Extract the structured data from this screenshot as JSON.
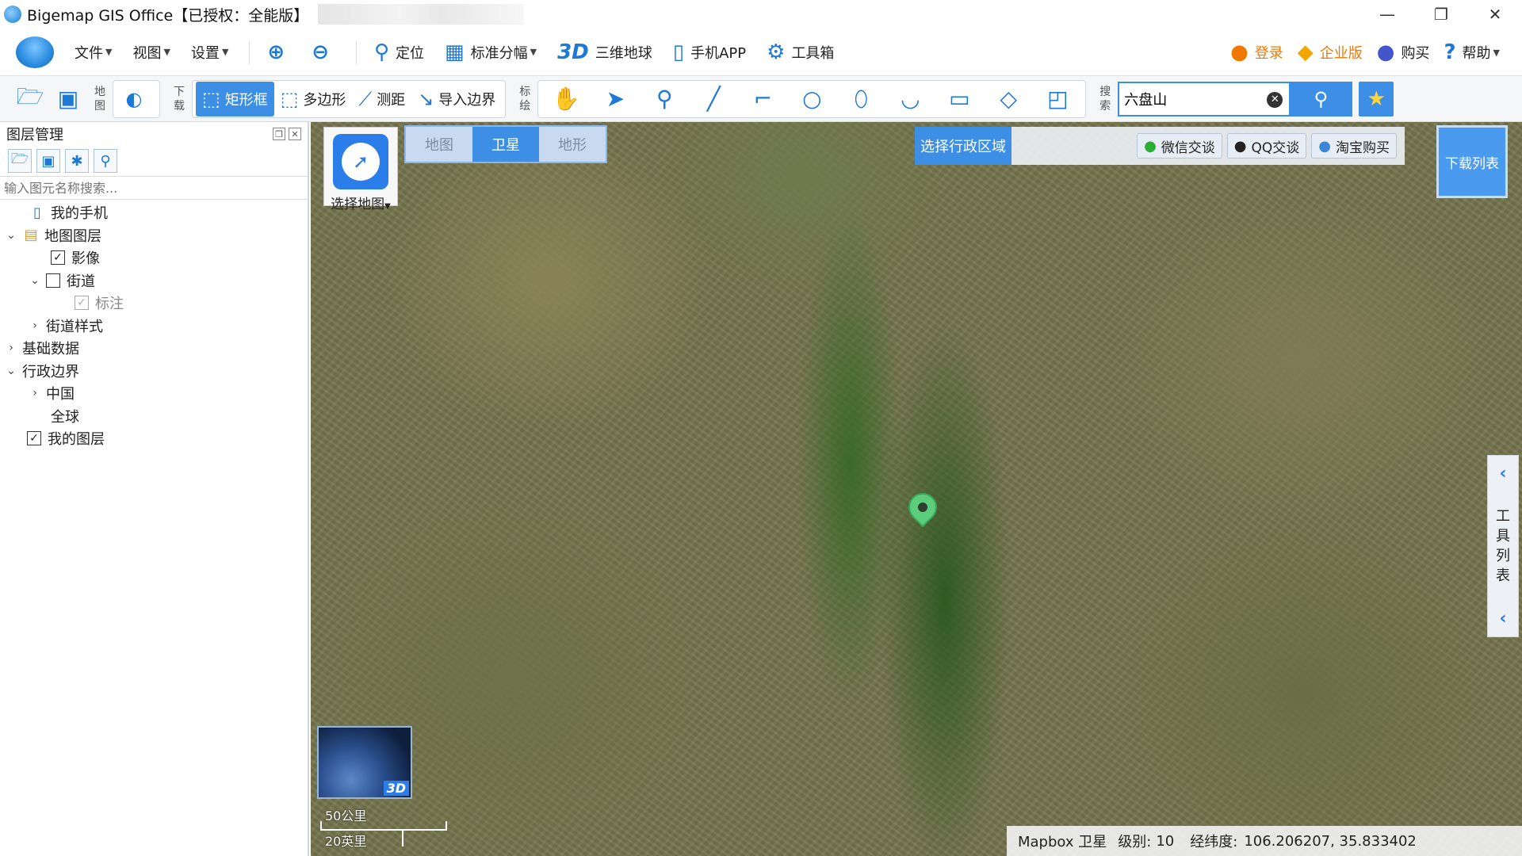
{
  "window": {
    "title": "Bigemap GIS Office【已授权：全能版】",
    "controls": {
      "minimize": "—",
      "restore": "❐",
      "close": "✕"
    }
  },
  "menubar": {
    "file": "文件",
    "view": "视图",
    "settings": "设置",
    "locate": "定位",
    "grid": "标准分幅",
    "globe_3d_prefix": "3D",
    "globe_3d": "三维地球",
    "mobile_app": "手机APP",
    "toolbox": "工具箱",
    "login": "登录",
    "enterprise": "企业版",
    "buy": "购买",
    "help": "帮助"
  },
  "toolbar": {
    "map_vlabel": "地图",
    "download_vlabel": "下载",
    "rect": "矩形框",
    "polygon": "多边形",
    "measure": "测距",
    "import_boundary": "导入边界",
    "draw_vlabel": "标绘",
    "search_vlabel": "搜索",
    "search_value": "六盘山"
  },
  "layer_panel": {
    "title": "图层管理",
    "search_placeholder": "输入图元名称搜索...",
    "tree": [
      {
        "label": "我的手机"
      },
      {
        "label": "地图图层"
      },
      {
        "label": "影像"
      },
      {
        "label": "街道"
      },
      {
        "label": "标注"
      },
      {
        "label": "街道样式"
      },
      {
        "label": "基础数据"
      },
      {
        "label": "行政边界"
      },
      {
        "label": "中国"
      },
      {
        "label": "全球"
      },
      {
        "label": "我的图层"
      }
    ]
  },
  "map": {
    "select_map": "选择地图",
    "map_types": [
      "地图",
      "卫星",
      "地形"
    ],
    "active_map_type": "卫星",
    "select_region": "选择行政区域",
    "chat": {
      "wechat": "微信交谈",
      "qq": "QQ交谈",
      "taobao": "淘宝购买"
    },
    "download_list": "下载列表",
    "tool_list": "工具列表",
    "mini3d_tag": "3D",
    "scale_km": "50公里",
    "scale_mi": "20英里",
    "status": {
      "source": "Mapbox 卫星",
      "level_label": "级别:",
      "level": "10",
      "coord_label": "经纬度:",
      "coords": "106.206207, 35.833402"
    }
  }
}
